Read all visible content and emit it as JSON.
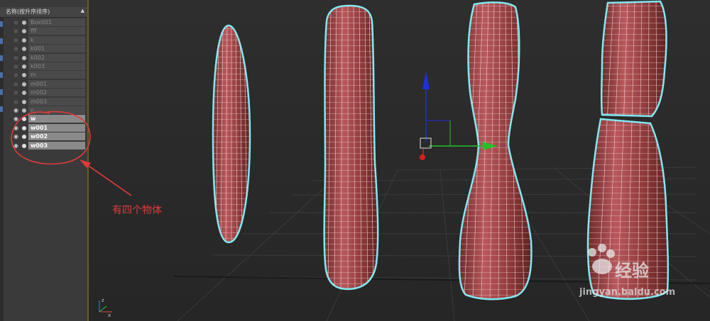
{
  "outliner": {
    "header": "名称(按升序排序)",
    "sort_arrow": "▲",
    "items": [
      {
        "name": "Box001",
        "visible": false,
        "selected": false
      },
      {
        "name": "fff",
        "visible": false,
        "selected": false
      },
      {
        "name": "k",
        "visible": false,
        "selected": false
      },
      {
        "name": "k001",
        "visible": false,
        "selected": false
      },
      {
        "name": "k002",
        "visible": false,
        "selected": false
      },
      {
        "name": "k003",
        "visible": false,
        "selected": false
      },
      {
        "name": "m",
        "visible": false,
        "selected": false
      },
      {
        "name": "m001",
        "visible": false,
        "selected": false
      },
      {
        "name": "m002",
        "visible": false,
        "selected": false
      },
      {
        "name": "m003",
        "visible": false,
        "selected": false
      },
      {
        "name": "n",
        "visible": true,
        "selected": false
      },
      {
        "name": "w",
        "visible": true,
        "selected": true
      },
      {
        "name": "w001",
        "visible": true,
        "selected": true
      },
      {
        "name": "w002",
        "visible": true,
        "selected": true
      },
      {
        "name": "w003",
        "visible": true,
        "selected": true
      }
    ]
  },
  "annotation": {
    "text": "有四个物体",
    "color": "#e23b3b"
  },
  "watermark": {
    "brand": "经验",
    "url": "jingyan.baidu.com"
  },
  "colors": {
    "mesh_fill": "#8e3a3a",
    "mesh_highlight": "#c0666a",
    "wire": "#e8c8c8",
    "selection_outline": "#7fe9f2",
    "grid": "#3c3c3c",
    "gizmo_z": "#1f2fd8",
    "gizmo_x": "#d82020",
    "gizmo_y": "#22c22a"
  },
  "viewport": {
    "axis_labels": [
      "z",
      "x"
    ]
  }
}
